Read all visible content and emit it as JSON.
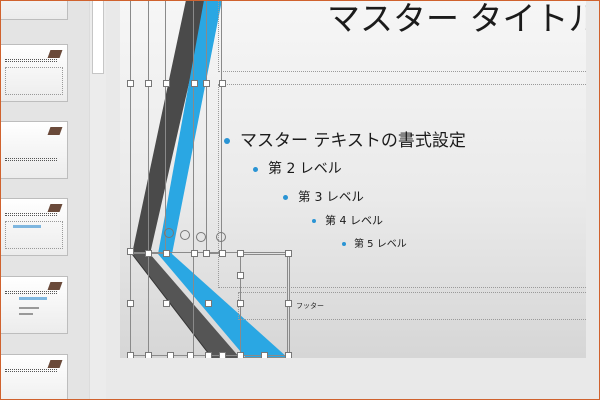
{
  "slide": {
    "title": "マスター タイトルの",
    "footer": "フッター",
    "levels": [
      {
        "label": "マスター テキストの書式設定"
      },
      {
        "label": "第 2 レベル"
      },
      {
        "label": "第 3 レベル"
      },
      {
        "label": "第 4 レベル"
      },
      {
        "label": "第 5 レベル"
      }
    ]
  },
  "colors": {
    "accent_blue": "#2aa7e3",
    "accent_gray": "#555555",
    "bullet": "#2a94d4",
    "frame": "#d0622e"
  }
}
